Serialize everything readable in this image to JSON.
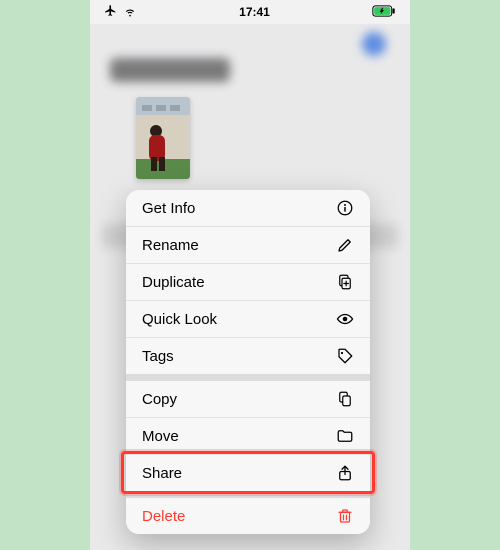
{
  "status": {
    "time": "17:41",
    "airplane": "✈",
    "wifi": "wifi",
    "battery": "charging"
  },
  "background": {
    "title_placeholder": "Recents"
  },
  "thumbnail": {
    "description": "video-thumbnail"
  },
  "menu": {
    "groups": [
      {
        "items": [
          {
            "id": "get-info",
            "label": "Get Info",
            "icon": "info-icon"
          },
          {
            "id": "rename",
            "label": "Rename",
            "icon": "pencil-icon"
          },
          {
            "id": "duplicate",
            "label": "Duplicate",
            "icon": "duplicate-icon"
          },
          {
            "id": "quicklook",
            "label": "Quick Look",
            "icon": "eye-icon"
          },
          {
            "id": "tags",
            "label": "Tags",
            "icon": "tag-icon"
          }
        ]
      },
      {
        "items": [
          {
            "id": "copy",
            "label": "Copy",
            "icon": "copy-icon"
          },
          {
            "id": "move",
            "label": "Move",
            "icon": "folder-icon"
          },
          {
            "id": "share",
            "label": "Share",
            "icon": "share-icon",
            "highlighted": true
          }
        ]
      },
      {
        "items": [
          {
            "id": "delete",
            "label": "Delete",
            "icon": "trash-icon",
            "danger": true
          }
        ]
      }
    ]
  },
  "colors": {
    "danger": "#ff3b30",
    "accent": "#2f6dde"
  }
}
